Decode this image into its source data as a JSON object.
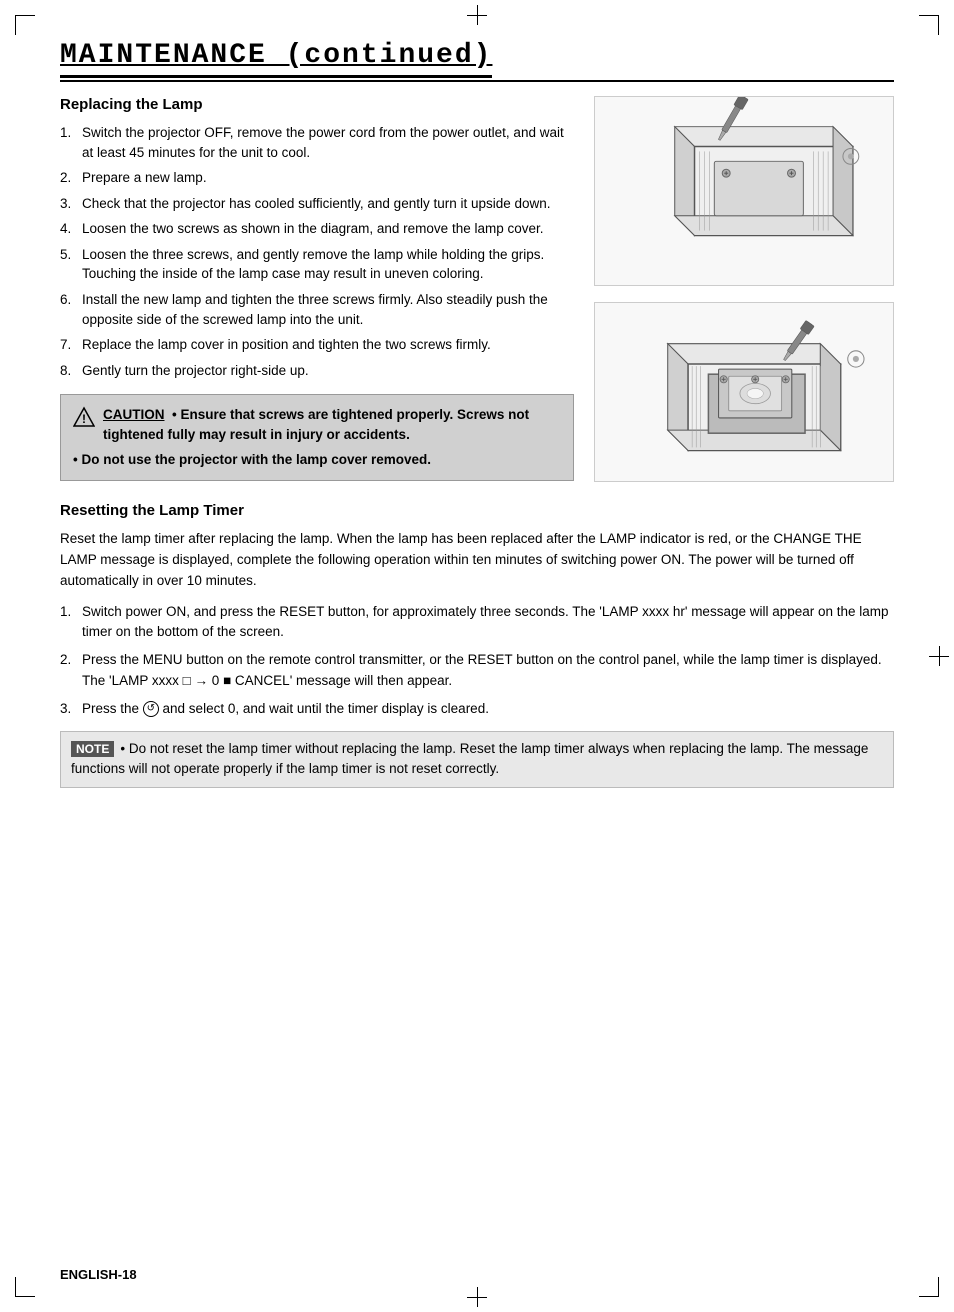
{
  "page": {
    "footer": "ENGLISH-18"
  },
  "title": {
    "text": "MAINTENANCE (continued)"
  },
  "replacing_lamp": {
    "heading": "Replacing the Lamp",
    "steps": [
      {
        "num": "1.",
        "text": "Switch the projector OFF, remove the power cord from the power outlet, and wait at least 45 minutes for the unit to cool."
      },
      {
        "num": "2.",
        "text": "Prepare a new lamp."
      },
      {
        "num": "3.",
        "text": "Check that the projector has cooled sufficiently, and gently turn it upside down."
      },
      {
        "num": "4.",
        "text": "Loosen the two screws as shown in the diagram, and remove the lamp cover."
      },
      {
        "num": "5.",
        "text": "Loosen the three screws, and gently remove the lamp while holding the grips. Touching the inside of the lamp case may result in uneven coloring."
      },
      {
        "num": "6.",
        "text": "Install the new lamp and tighten the three screws firmly. Also steadily push the opposite side of the screwed lamp into the unit."
      },
      {
        "num": "7.",
        "text": "Replace the lamp cover in position and tighten the  two screws firmly."
      },
      {
        "num": "8.",
        "text": "Gently turn the projector right-side up."
      }
    ]
  },
  "caution": {
    "label": "CAUTION",
    "text1": "• Ensure that screws are tightened properly. Screws not tightened fully may result in injury or accidents.",
    "text2": "• Do not use the projector with the lamp cover removed."
  },
  "resetting": {
    "heading": "Resetting the Lamp Timer",
    "intro": "Reset the lamp timer after replacing the lamp. When the lamp has been replaced after the LAMP indicator is red, or the CHANGE THE LAMP message is displayed, complete the following operation within ten minutes of switching power ON. The power will be turned off automatically in over 10 minutes.",
    "steps": [
      {
        "num": "1.",
        "text": "Switch power ON, and press the RESET button, for approximately three seconds. The 'LAMP xxxx hr' message will appear on the lamp timer on the bottom of the screen."
      },
      {
        "num": "2.",
        "text": "Press the MENU button on the remote control transmitter, or the RESET button on the control panel, while the lamp timer is displayed. The 'LAMP xxxx □ → 0 ■ CANCEL' message will then appear."
      },
      {
        "num": "3.",
        "text": "Press the ↺ and select 0, and wait until the timer display is cleared."
      }
    ],
    "note_label": "NOTE",
    "note_text": "• Do not reset the lamp timer without replacing the lamp. Reset the lamp timer always when replacing the lamp. The message functions will not operate  properly if the lamp timer is not reset correctly."
  }
}
